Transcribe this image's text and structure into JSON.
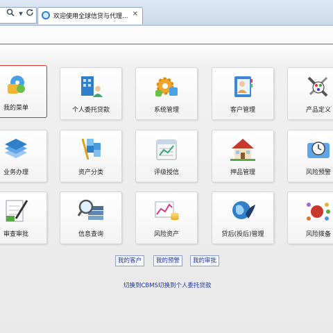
{
  "browser": {
    "tab_title": "欢迎使用全球信贷与代理...",
    "icons": [
      "search-icon",
      "dropdown-icon",
      "refresh-icon",
      "ie-icon",
      "close-icon"
    ]
  },
  "accent_color": "#d43a3a",
  "menu": {
    "rows": [
      [
        "我的菜单",
        "个人委托贷款",
        "系统管理",
        "客户管理",
        "产品定义"
      ],
      [
        "业务办理",
        "资产分类",
        "评级授信",
        "押品管理",
        "风险预警"
      ],
      [
        "审查审批",
        "信息查询",
        "风险资产",
        "贷后(投后)管理",
        "风险拨备"
      ]
    ],
    "icons": [
      [
        "puzzle-gear-icon",
        "building-person-icon",
        "gear-puzzle-icon",
        "address-book-icon",
        "tools-palette-icon"
      ],
      [
        "document-stack-icon",
        "cube-chart-icon",
        "calendar-pad-icon",
        "house-icon",
        "clock-folder-icon"
      ],
      [
        "checklist-pen-icon",
        "magnifier-docs-icon",
        "chart-coins-icon",
        "globe-leaf-icon",
        "color-dots-icon"
      ]
    ],
    "selected": "我的菜单"
  },
  "quick_links": [
    "我的客户",
    "我的预警",
    "我的审批"
  ],
  "switch_links": [
    "切换到CBMS",
    "切换到个人委托贷款"
  ]
}
